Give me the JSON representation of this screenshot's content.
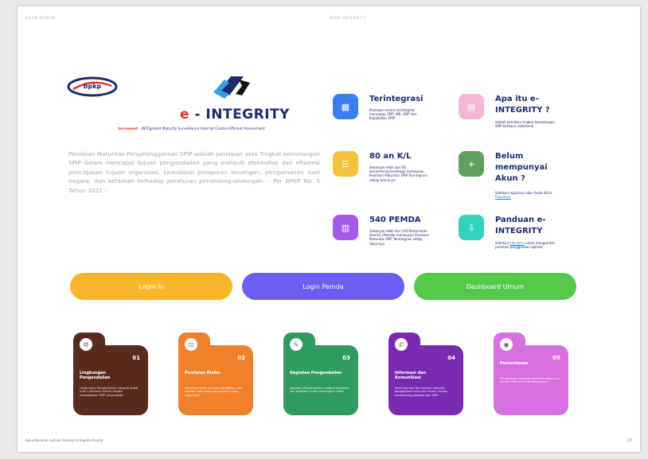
{
  "page": {
    "header_left": "AGAM DARYN",
    "header_center": "BPKP INTEGRITY",
    "footer_left": "Buku Panduan Aplikasi Daring e-Integrity Kinerja",
    "footer_right": "1/2"
  },
  "logos": {
    "bpkp_text": "bpkp",
    "brand_prefix": "e",
    "brand_name": " - INTEGRITY",
    "tagline_label": "Increment",
    "tagline_rest": " - INTEgrated Maturity Surveillance Internal Control Efficient Assessment"
  },
  "description": "Penilaian Maturitas Penyelenggaraan SPIP adalah penilaian atas Tingkat kematangan SPIP dalam mencapai tujuan pengendalian yang meliputi efektivitas dan efisiensi pencapaian tujuan organisasi, keandalan pelaporan keuangan, pengamanan aset negara, dan ketaatan terhadap peraturan perundang-undangan. - Per BPKP No. 5 Tahun 2021 -",
  "features": [
    {
      "title": "Terintegrasi",
      "sub": "Penilaian secara terintegrasi mencakup SPIP, MR, APIP dan Kapabilitas APIP"
    },
    {
      "title": "Apa itu e-INTEGRITY ?",
      "sub": "adalah penilaian tingkat kematangan SPIP berbasis elektronik"
    },
    {
      "title": "80 an K/L",
      "sub": "Sebanyak lebih dari 80 Kementerian/Lembaga melakukan Penilaian Maturitas SPIP Terintegrasi setiap tahunnya"
    },
    {
      "title": "Belum mempunyai Akun ?",
      "sub_pre": "Silahkan registrasi akun Anda disini.",
      "sub_link": "Registrasi"
    },
    {
      "title": "540 PEMDA",
      "sub": "Sebanyak lebih dari 540 Pemerintah Daerah (Pemda) melakukan Penilaian Maturitas SPIP Terintegrasi setiap tahunnya"
    },
    {
      "title": "Panduan e-INTEGRITY",
      "sub_pre": "Silahkan",
      "sub_link": "klik disini",
      "sub_post": "untuk mengunduh panduan penggunaan aplikasi."
    }
  ],
  "buttons": {
    "login": "Login In",
    "login_pemda": "Login Pemda",
    "dashboard": "Dashboard Umum"
  },
  "cards": [
    {
      "num": "01",
      "title": "Lingkungan Pengendalian",
      "desc": "Lingkungan Pengendalian meliputi enam unsur penilaian dalam rangka menegakkan SPIP yang efektif."
    },
    {
      "num": "02",
      "title": "Penilaian Risiko",
      "desc": "Penilaian Risiko meliputi identifikasi dan analisis risiko atas pencapaian tujuan organisasi."
    },
    {
      "num": "03",
      "title": "Kegiatan Pengendalian",
      "desc": "Kegiatan Pengendalian meliputi kebijakan dan prosedur untuk menangani risiko."
    },
    {
      "num": "04",
      "title": "Informasi dan Komunikasi",
      "desc": "Informasi dan Komunikasi meliputi pengelolaan informasi dalam rangka mendukung pelaksanaan SPIP."
    },
    {
      "num": "05",
      "title": "Pemantauan",
      "desc": "Pemantauan meliputi penilaian atas mutu kinerja SPIP secara berkelanjutan."
    }
  ],
  "colors": {
    "navy": "#1e2a6e",
    "feature_icons": [
      "#3a7ff0",
      "#f6b6d8",
      "#f2c23a",
      "#5ea15e",
      "#a559e8",
      "#34d3bd"
    ],
    "buttons": [
      "#f8b62b",
      "#6a5ff2",
      "#54c94a"
    ],
    "cards": [
      "#5a2a1c",
      "#f0812a",
      "#2f9b5e",
      "#7a2ab0",
      "#d770e0"
    ]
  },
  "icons": {
    "features": [
      "grid-icon",
      "book-icon",
      "list-icon",
      "user-plus-icon",
      "building-icon",
      "download-icon"
    ],
    "cards": [
      "gear-icon",
      "scale-icon",
      "clipboard-icon",
      "megaphone-icon",
      "eye-icon"
    ]
  }
}
